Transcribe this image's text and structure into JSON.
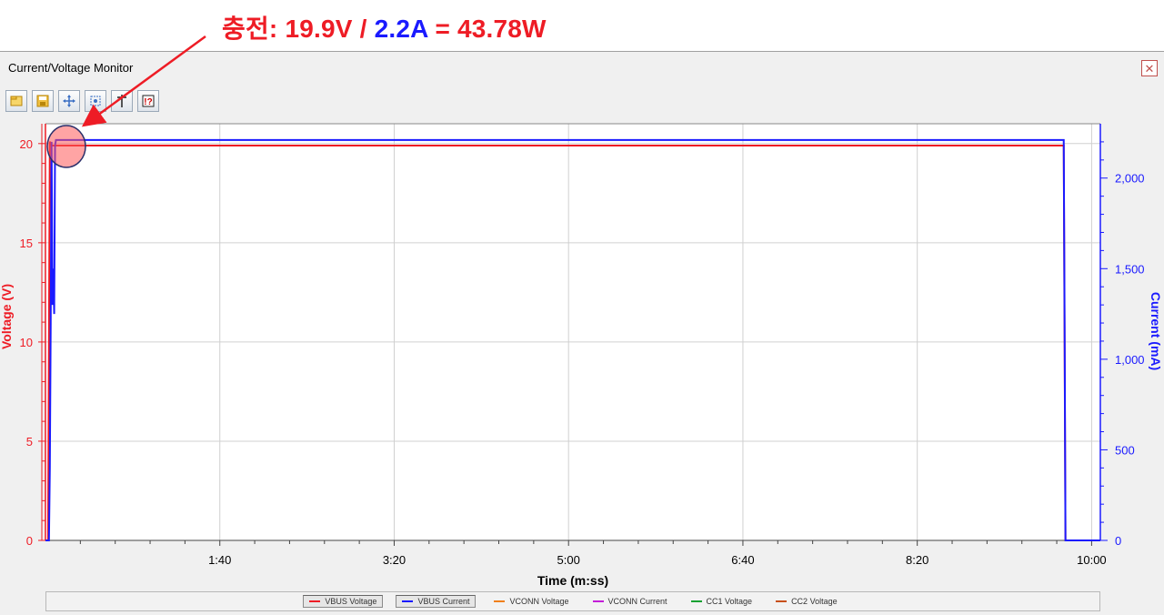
{
  "annotation": {
    "label_prefix": "충전: ",
    "voltage_text": "19.9V",
    "sep": " / ",
    "current_text": "2.2A",
    "result_text": " = 43.78W",
    "red": "#ee1c25",
    "blue": "#1a1aff"
  },
  "window": {
    "title": "Current/Voltage Monitor",
    "close_label": "x"
  },
  "toolbar": {
    "buttons": [
      "open-icon",
      "save-icon",
      "zoom-in-icon",
      "zoom-fit-icon",
      "cursor-icon",
      "settings-icon"
    ]
  },
  "chart_data": {
    "type": "line",
    "xlabel": "Time (m:ss)",
    "ylabel_left": "Voltage (V)",
    "ylabel_right": "Current (mA)",
    "x_unit": "seconds",
    "xlim": [
      0,
      605
    ],
    "x_ticks": [
      100,
      200,
      300,
      400,
      500,
      600
    ],
    "x_tick_labels": [
      "1:40",
      "3:20",
      "5:00",
      "6:40",
      "8:20",
      "10:00"
    ],
    "ylim_left": [
      0,
      21
    ],
    "y_ticks_left": [
      0,
      5,
      10,
      15,
      20
    ],
    "y_tick_labels_left": [
      "0",
      "5",
      "10",
      "15",
      "20"
    ],
    "ylim_right": [
      0,
      2300
    ],
    "y_ticks_right": [
      0,
      500,
      1000,
      1500,
      2000
    ],
    "y_tick_labels_right": [
      "0",
      "500",
      "1,000",
      "1,500",
      "2,000"
    ],
    "grid": true,
    "series": [
      {
        "name": "VBUS Voltage",
        "axis": "left",
        "color": "#ee1c25",
        "x": [
          0,
          1.5,
          2.5,
          3.5,
          5,
          100,
          200,
          300,
          400,
          500,
          584,
          585,
          605
        ],
        "y": [
          0,
          0,
          20.1,
          19.9,
          19.9,
          19.9,
          19.9,
          19.9,
          19.9,
          19.9,
          19.9,
          0,
          0
        ]
      },
      {
        "name": "VBUS Current",
        "axis": "left_mirror",
        "axis_real": "right",
        "color": "#1a1aff",
        "x": [
          0,
          2,
          2.5,
          3,
          3.5,
          4,
          4.5,
          5,
          5.5,
          6,
          100,
          200,
          300,
          400,
          500,
          584,
          584.5,
          585,
          605
        ],
        "y": [
          0,
          0,
          400,
          1200,
          2200,
          1300,
          1500,
          1250,
          2180,
          2210,
          2210,
          2210,
          2210,
          2210,
          2210,
          2210,
          1200,
          0,
          0
        ]
      },
      {
        "name": "VCONN Voltage",
        "color": "#f07f1a"
      },
      {
        "name": "VCONN Current",
        "color": "#c31ed8"
      },
      {
        "name": "CC1 Voltage",
        "color": "#15a131"
      },
      {
        "name": "CC2 Voltage",
        "color": "#c8501a"
      }
    ],
    "legend_position": "bottom"
  }
}
